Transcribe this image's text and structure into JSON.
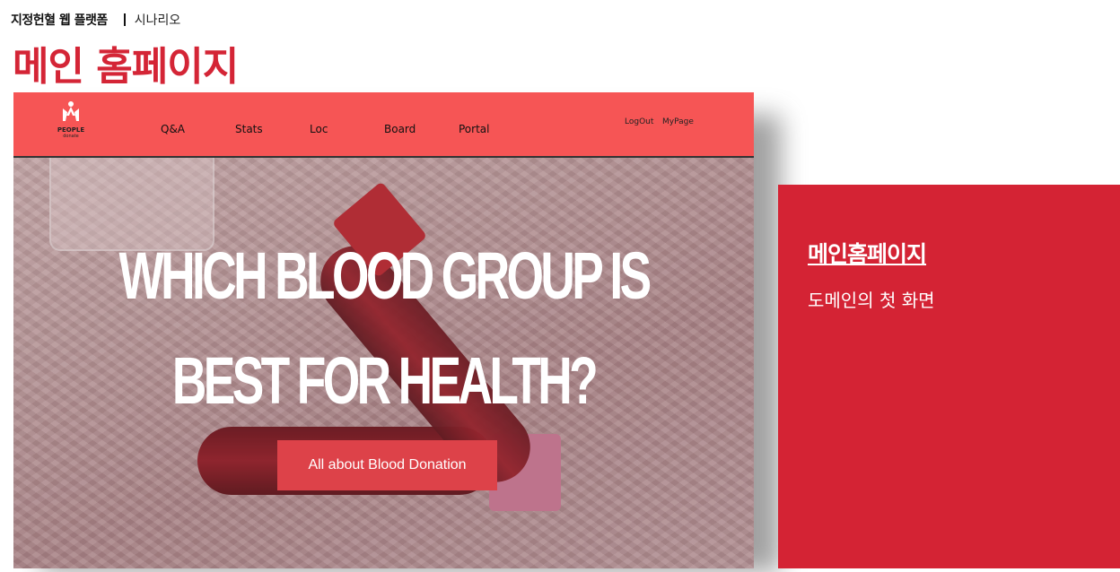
{
  "header": {
    "project": "지정헌혈 웹 플랫폼",
    "section": "시나리오",
    "title": "메인 홈페이지"
  },
  "site": {
    "logo": {
      "line1": "PEOPLE",
      "line2": "donate"
    },
    "nav": [
      "Q&A",
      "Stats",
      "Loc",
      "Board",
      "Portal"
    ],
    "account": {
      "logout": "LogOut",
      "mypage": "MyPage"
    },
    "hero": {
      "line1": "WHICH BLOOD GROUP IS",
      "line2": "BEST FOR HEALTH?",
      "cta": "All about Blood Donation"
    },
    "colors": {
      "nav": "#f65555",
      "cta": "#dd4249"
    }
  },
  "panel": {
    "title": "메인홈페이지",
    "description": "도메인의 첫 화면",
    "color": "#d42334"
  }
}
